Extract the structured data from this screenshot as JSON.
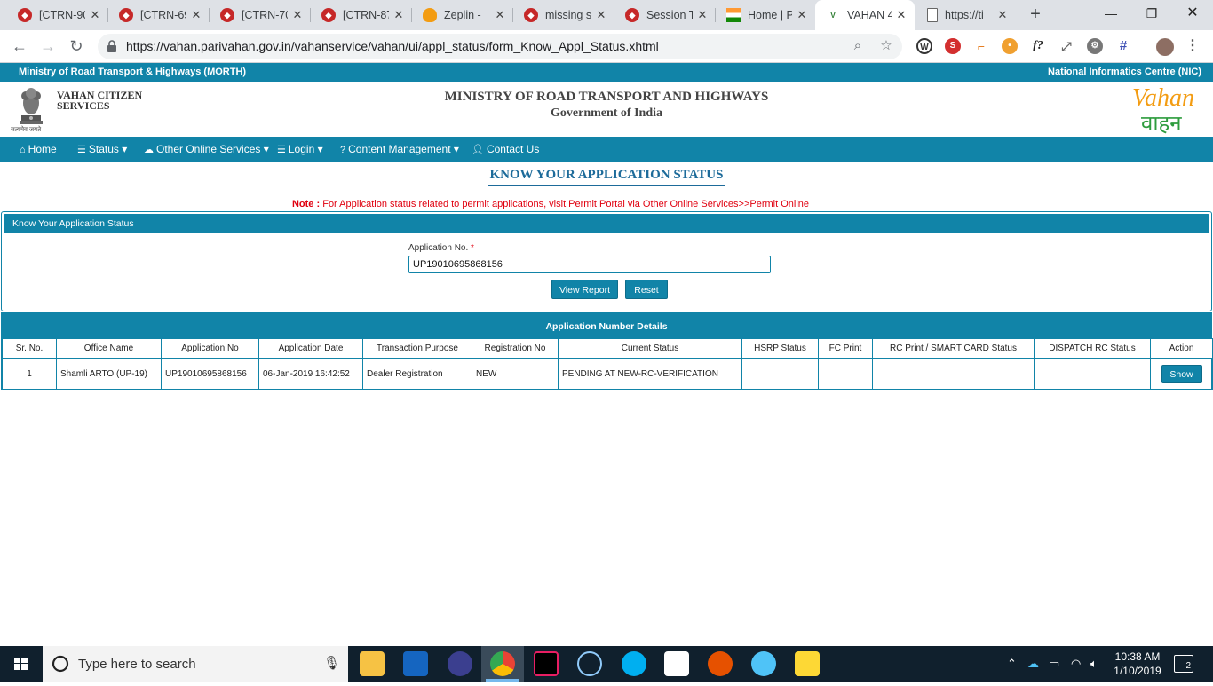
{
  "browser": {
    "tabs": [
      {
        "title": "[CTRN-90",
        "active": false
      },
      {
        "title": "[CTRN-69",
        "active": false
      },
      {
        "title": "[CTRN-70",
        "active": false
      },
      {
        "title": "[CTRN-87",
        "active": false
      },
      {
        "title": "Zeplin - ",
        "active": false
      },
      {
        "title": "missing s",
        "active": false
      },
      {
        "title": "Session T",
        "active": false
      },
      {
        "title": "Home | P",
        "active": false
      },
      {
        "title": "VAHAN 4",
        "active": true
      },
      {
        "title": "https://ti",
        "active": false
      }
    ],
    "url": "https://vahan.parivahan.gov.in/vahanservice/vahan/ui/appl_status/form_Know_Appl_Status.xhtml"
  },
  "topstrip": {
    "left": "Ministry of Road Transport & Highways (MORTH)",
    "right": "National Informatics Centre (NIC)"
  },
  "header": {
    "citizen_services": "VAHAN CITIZEN SERVICES",
    "emblem_motto": "सत्यमेव जयते",
    "ministry": "MINISTRY OF ROAD TRANSPORT AND HIGHWAYS",
    "government": "Government of India",
    "logo_text": "Vahan",
    "logo_hindi": "वाहन"
  },
  "menu": {
    "home": "Home",
    "status": "Status ▾",
    "other": "Other Online Services ▾",
    "login": "Login ▾",
    "content": "Content Management ▾",
    "contact": "Contact Us"
  },
  "page": {
    "title": "KNOW YOUR APPLICATION STATUS",
    "note_label": "Note :",
    "note_text": "For Application status related to permit applications, visit Permit Portal via Other Online Services>>Permit Online"
  },
  "form": {
    "panel_title": "Know Your Application Status",
    "label": "Application No.",
    "required": "*",
    "value": "UP19010695868156",
    "view_report": "View Report",
    "reset": "Reset"
  },
  "details": {
    "title": "Application Number Details",
    "columns": [
      "Sr. No.",
      "Office Name",
      "Application No",
      "Application Date",
      "Transaction Purpose",
      "Registration No",
      "Current Status",
      "HSRP Status",
      "FC Print",
      "RC Print / SMART CARD Status",
      "DISPATCH RC Status",
      "Action"
    ],
    "row": {
      "sr": "1",
      "office": "Shamli ARTO (UP-19)",
      "appl_no": "UP19010695868156",
      "date": "06-Jan-2019 16:42:52",
      "purpose": "Dealer Registration",
      "reg_no": "NEW",
      "status": "PENDING AT NEW-RC-VERIFICATION",
      "hsrp": "",
      "fc": "",
      "rc": "",
      "dispatch": "",
      "action": "Show"
    }
  },
  "taskbar": {
    "search_placeholder": "Type here to search",
    "time": "10:38 AM",
    "date": "1/10/2019",
    "notifications": "2"
  },
  "colors": {
    "primary": "#1184a8",
    "note_red": "#e0000f",
    "title_blue": "#1d6b9a"
  }
}
